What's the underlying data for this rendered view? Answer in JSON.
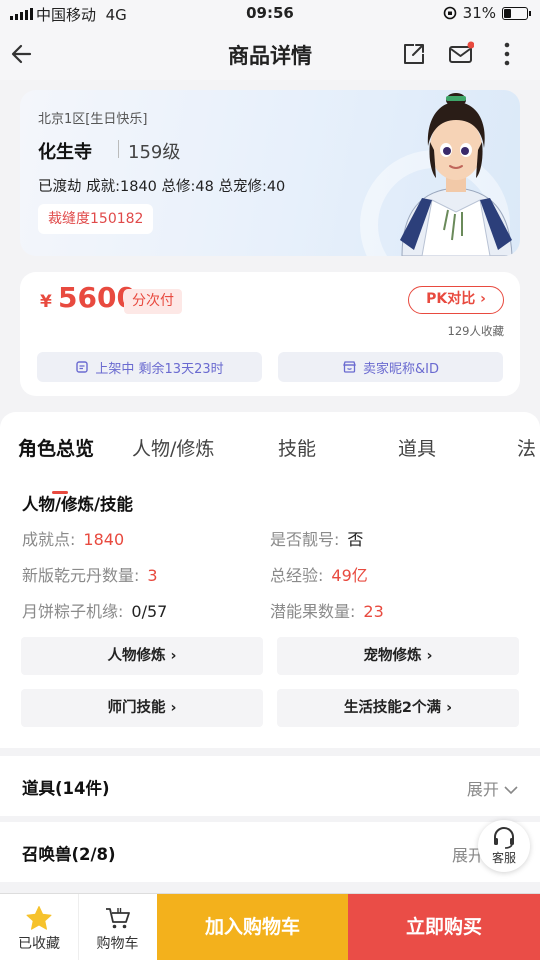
{
  "status_bar": {
    "carrier": "中国移动",
    "network": "4G",
    "time": "09:56",
    "battery_text": "31%",
    "battery_level": 0.31
  },
  "nav": {
    "title": "商品详情",
    "icons": [
      "back-arrow-icon",
      "share-icon",
      "mail-icon",
      "more-icon"
    ]
  },
  "role": {
    "server": "北京1区[生日快乐]",
    "sect": "化生寺",
    "level": "159级",
    "stats": "已渡劫 成就:1840 总修:48 总宠修:40",
    "badge": "裁缝度150182"
  },
  "price": {
    "currency": "¥",
    "amount": "5600",
    "installment": "分次付",
    "pk_label": "PK对比",
    "favorites": "129人收藏",
    "listing_status": "上架中 剩余13天23时",
    "seller_label": "卖家昵称&ID"
  },
  "tabs": [
    "角色总览",
    "人物/修炼",
    "技能",
    "道具",
    "法"
  ],
  "overview": {
    "section_title": "人物/修炼/技能",
    "rows": [
      {
        "k": "成就点:",
        "v": "1840"
      },
      {
        "k": "是否靓号:",
        "v": "否"
      },
      {
        "k": "新版乾元丹数量:",
        "v": "3"
      },
      {
        "k": "总经验:",
        "v": "49亿"
      },
      {
        "k": "月饼粽子机缘:",
        "v": "0/57"
      },
      {
        "k": "潜能果数量:",
        "v": "23"
      }
    ],
    "buttons": [
      "人物修炼",
      "宠物修炼",
      "师门技能",
      "生活技能2个满"
    ]
  },
  "folds": [
    {
      "title": "道具(14件)",
      "action": "展开"
    },
    {
      "title": "召唤兽(2/8)",
      "action": "展开"
    }
  ],
  "service": {
    "label": "客服"
  },
  "bottom_bar": {
    "favorited_label": "已收藏",
    "cart_label": "购物车",
    "add_to_cart": "加入购物车",
    "buy_now": "立即购买"
  },
  "colors": {
    "accent_red": "#e84a3f",
    "cart_yellow": "#f3b11c",
    "buy_red": "#ea4d47",
    "pill_purple": "#6a6ad0"
  }
}
